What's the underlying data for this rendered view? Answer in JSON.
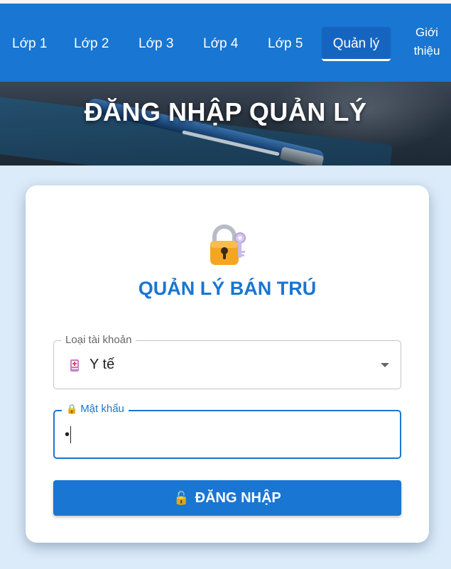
{
  "nav": {
    "items": [
      {
        "label": "Lớp 1"
      },
      {
        "label": "Lớp 2"
      },
      {
        "label": "Lớp 3"
      },
      {
        "label": "Lớp 4"
      },
      {
        "label": "Lớp 5"
      },
      {
        "label": "Quản lý",
        "active": true
      },
      {
        "label": "Giới thiệu"
      }
    ]
  },
  "hero": {
    "title": "ĐĂNG NHẬP QUẢN LÝ"
  },
  "card": {
    "title": "QUẢN LÝ BÁN TRÚ",
    "icon": "lock-with-key-icon",
    "account_type": {
      "label": "Loại tài khoản",
      "value": "Y tế",
      "icon": "medical-icon"
    },
    "password": {
      "label": "Mật khẩu",
      "value": "•",
      "icon": "lock-icon"
    },
    "login_button": {
      "label": "ĐĂNG NHẬP",
      "icon": "unlock-icon"
    }
  },
  "colors": {
    "primary": "#1976d2",
    "background": "#dcebf9"
  }
}
